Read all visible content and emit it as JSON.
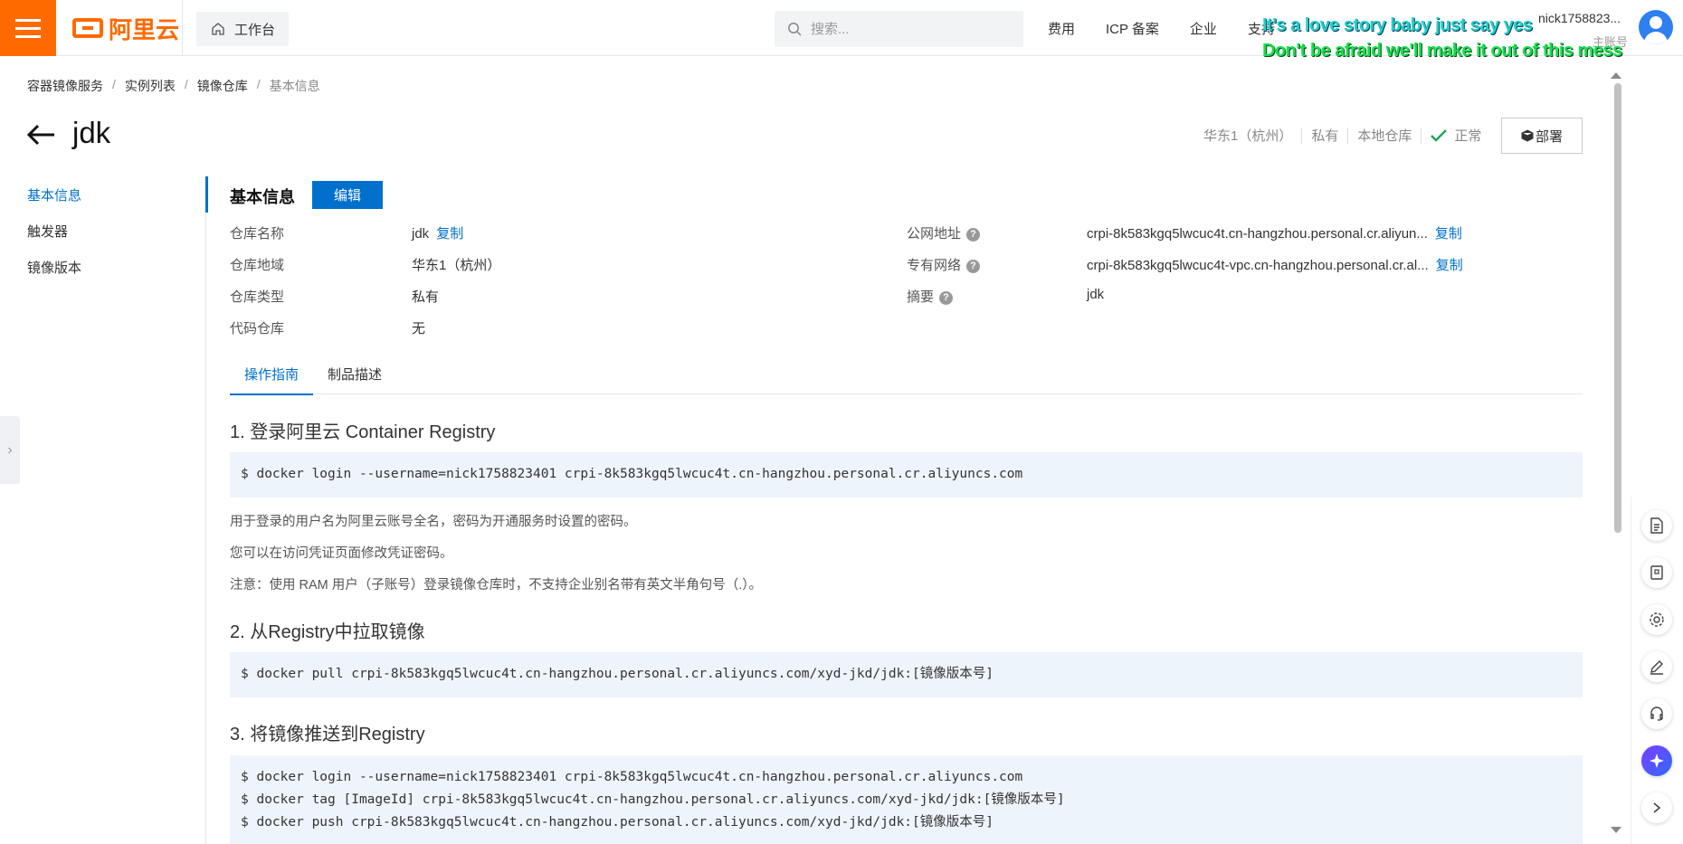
{
  "topbar": {
    "logo_text": "阿里云",
    "workbench_label": "工作台",
    "search_placeholder": "搜索...",
    "nav": [
      "费用",
      "ICP 备案",
      "企业",
      "支持"
    ],
    "user_name": "nick1758823...",
    "user_sub": "主账号"
  },
  "overlay": {
    "lyric_line1": "It's a love story baby just say yes",
    "lyric_line2": "Don't be afraid we'll make it out of this mess"
  },
  "breadcrumb": [
    "容器镜像服务",
    "实例列表",
    "镜像仓库",
    "基本信息"
  ],
  "header": {
    "title": "jdk",
    "region": "华东1（杭州）",
    "visibility": "私有",
    "repo_source": "本地仓库",
    "status": "正常",
    "deploy_label": "部署"
  },
  "sidebar": {
    "items": [
      {
        "label": "基本信息",
        "active": true
      },
      {
        "label": "触发器",
        "active": false
      },
      {
        "label": "镜像版本",
        "active": false
      }
    ]
  },
  "basic_info": {
    "section_title": "基本信息",
    "edit_label": "编辑",
    "copy_label": "复制",
    "left": [
      {
        "label": "仓库名称",
        "value": "jdk"
      },
      {
        "label": "仓库地域",
        "value": "华东1（杭州）"
      },
      {
        "label": "仓库类型",
        "value": "私有"
      },
      {
        "label": "代码仓库",
        "value": "无"
      }
    ],
    "right": [
      {
        "label": "公网地址",
        "value": "crpi-8k583kgq5lwcuc4t.cn-hangzhou.personal.cr.aliyun..."
      },
      {
        "label": "专有网络",
        "value": "crpi-8k583kgq5lwcuc4t-vpc.cn-hangzhou.personal.cr.al..."
      },
      {
        "label": "摘要",
        "value": "jdk"
      }
    ]
  },
  "tabs": [
    {
      "label": "操作指南",
      "active": true
    },
    {
      "label": "制品描述",
      "active": false
    }
  ],
  "guide": {
    "step1_title": "1. 登录阿里云 Container Registry",
    "step1_code": [
      "$ docker login --username=nick1758823401 crpi-8k583kgq5lwcuc4t.cn-hangzhou.personal.cr.aliyuncs.com"
    ],
    "step1_notes": [
      "用于登录的用户名为阿里云账号全名，密码为开通服务时设置的密码。",
      "您可以在访问凭证页面修改凭证密码。",
      "注意：使用 RAM 用户（子账号）登录镜像仓库时，不支持企业别名带有英文半角句号（.）。"
    ],
    "step2_title": "2. 从Registry中拉取镜像",
    "step2_code": [
      "$ docker pull crpi-8k583kgq5lwcuc4t.cn-hangzhou.personal.cr.aliyuncs.com/xyd-jkd/jdk:[镜像版本号]"
    ],
    "step3_title": "3. 将镜像推送到Registry",
    "step3_code": [
      "$ docker login --username=nick1758823401 crpi-8k583kgq5lwcuc4t.cn-hangzhou.personal.cr.aliyuncs.com",
      "$ docker tag [ImageId] crpi-8k583kgq5lwcuc4t.cn-hangzhou.personal.cr.aliyuncs.com/xyd-jkd/jdk:[镜像版本号]",
      "$ docker push crpi-8k583kgq5lwcuc4t.cn-hangzhou.personal.cr.aliyuncs.com/xyd-jkd/jdk:[镜像版本号]"
    ]
  },
  "colors": {
    "brand": "#ff6a00",
    "link": "#0070cc",
    "success": "#23a454"
  },
  "float_toolbar_icons": [
    "document-icon",
    "snapshot-icon",
    "settings-icon",
    "edit-icon",
    "support-icon",
    "ai-assistant-icon",
    "expand-icon"
  ]
}
